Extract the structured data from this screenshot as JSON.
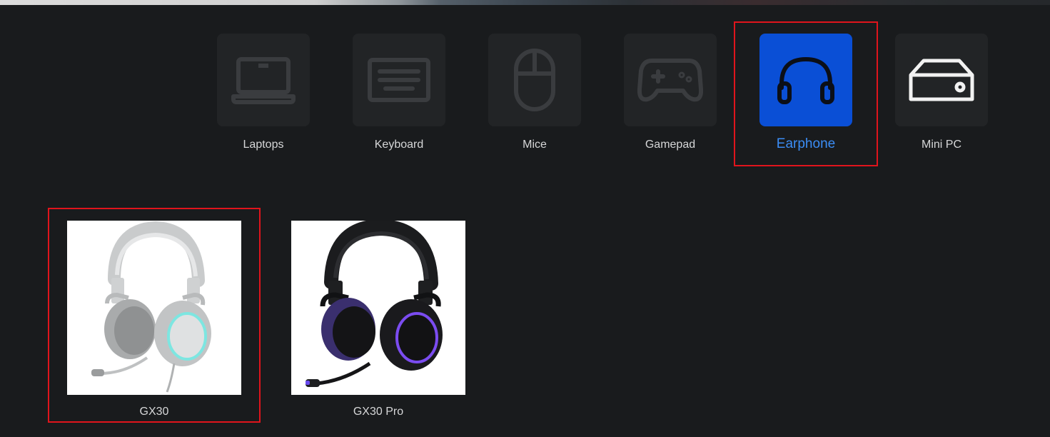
{
  "categories": [
    {
      "id": "laptops",
      "label": "Laptops",
      "icon": "laptop-icon",
      "active": false
    },
    {
      "id": "keyboard",
      "label": "Keyboard",
      "icon": "keyboard-icon",
      "active": false
    },
    {
      "id": "mice",
      "label": "Mice",
      "icon": "mouse-icon",
      "active": false
    },
    {
      "id": "gamepad",
      "label": "Gamepad",
      "icon": "gamepad-icon",
      "active": false
    },
    {
      "id": "earphone",
      "label": "Earphone",
      "icon": "headphones-icon",
      "active": true
    },
    {
      "id": "mini-pc",
      "label": "Mini PC",
      "icon": "mini-pc-icon",
      "active": false
    }
  ],
  "products": [
    {
      "name": "GX30",
      "image": "white-headset-image",
      "highlighted": true
    },
    {
      "name": "GX30 Pro",
      "image": "black-purple-headset-image",
      "highlighted": false
    }
  ],
  "colors": {
    "background": "#191b1d",
    "tile": "#222426",
    "active_tile": "#0a4fd6",
    "active_label": "#3b8df5",
    "highlight_border": "#e0141c"
  }
}
